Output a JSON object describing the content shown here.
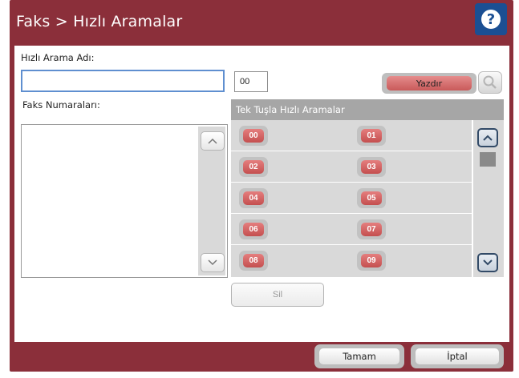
{
  "header": {
    "title": "Faks > Hızlı Aramalar",
    "help_icon": "help-icon",
    "help_glyph": "?"
  },
  "colors": {
    "frame": "#8b2f3a",
    "help_button": "#1b4f93",
    "input_focus": "#5f8fd0",
    "speed_dial_button": "#d86868",
    "panel_gray": "#d9d9d9"
  },
  "form": {
    "speed_dial_name_label": "Hızlı Arama Adı:",
    "speed_dial_name_value": "",
    "fax_numbers_label": "Faks Numaraları:",
    "speed_dial_number_value": "00"
  },
  "toolbar": {
    "print_label": "Yazdır",
    "search_icon": "magnifier-icon"
  },
  "speed_dials": {
    "header": "Tek Tuşla Hızlı Aramalar",
    "buttons": [
      "00",
      "01",
      "02",
      "03",
      "04",
      "05",
      "06",
      "07",
      "08",
      "09"
    ]
  },
  "actions": {
    "delete_label": "Sil",
    "ok_label": "Tamam",
    "cancel_label": "İptal"
  }
}
